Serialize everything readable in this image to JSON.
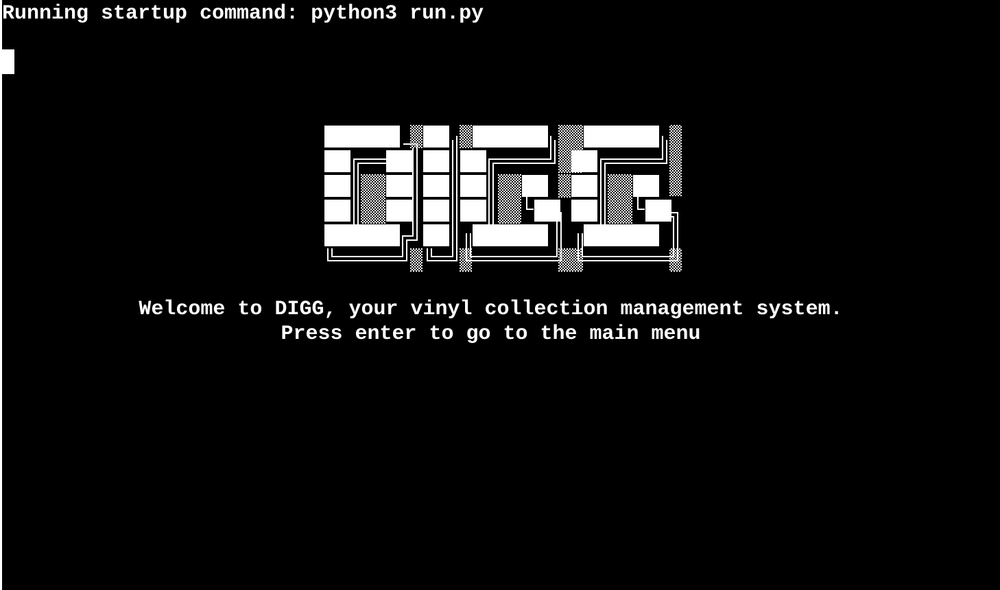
{
  "terminal": {
    "startup_command": "Running startup command: python3 run.py",
    "welcome_message": "Welcome to DIGG, your vinyl collection management system.",
    "prompt_message": "Press enter to go to the main menu"
  },
  "logo": {
    "name": "DIGG",
    "foreground": "#ffffff",
    "background": "#000000"
  }
}
